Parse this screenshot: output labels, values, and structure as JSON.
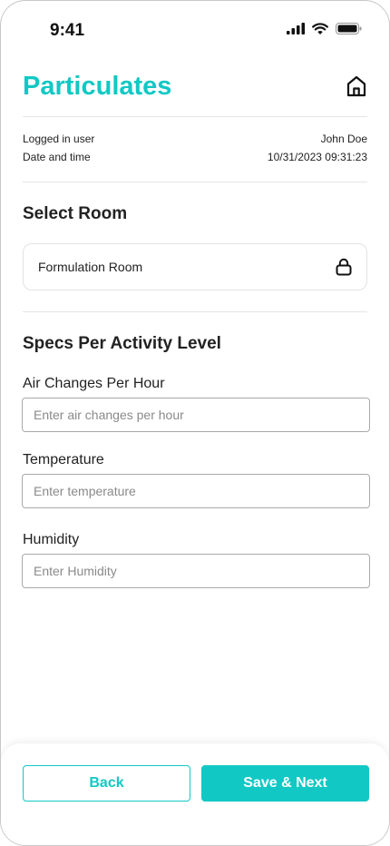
{
  "status_bar": {
    "time": "9:41"
  },
  "header": {
    "title": "Particulates",
    "home_icon": "home-icon"
  },
  "session": {
    "user_label": "Logged in user",
    "user_value": "John Doe",
    "datetime_label": "Date and time",
    "datetime_value": "10/31/2023 09:31:23"
  },
  "room": {
    "section_title": "Select Room",
    "selected": "Formulation Room",
    "icon": "lock-icon"
  },
  "specs": {
    "section_title": "Specs Per Activity Level",
    "fields": [
      {
        "label": "Air Changes Per Hour",
        "placeholder": "Enter air changes per hour",
        "value": ""
      },
      {
        "label": "Temperature",
        "placeholder": "Enter temperature",
        "value": ""
      },
      {
        "label": "Humidity",
        "placeholder": "Enter Humidity",
        "value": ""
      }
    ]
  },
  "footer": {
    "back_label": "Back",
    "next_label": "Save & Next"
  },
  "colors": {
    "accent": "#12c8c4"
  }
}
